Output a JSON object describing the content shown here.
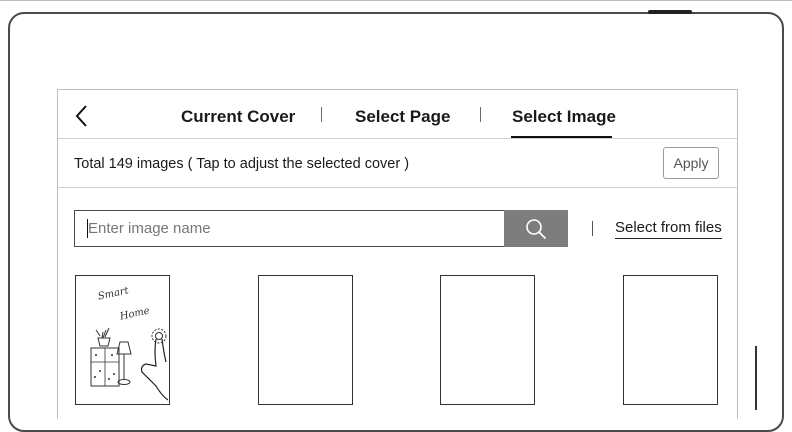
{
  "header": {
    "tabs": [
      {
        "label": "Current Cover",
        "selected": false
      },
      {
        "label": "Select Page",
        "selected": false
      },
      {
        "label": "Select Image",
        "selected": true
      }
    ]
  },
  "summary": {
    "total_text": "Total 149 images ( Tap to adjust the selected cover )",
    "apply_label": "Apply"
  },
  "search": {
    "placeholder": "Enter image name",
    "value": "",
    "icon": "search-icon"
  },
  "files": {
    "label": "Select from files"
  },
  "images": [
    {
      "name": "smart-home",
      "caption": "Smart Home"
    },
    {
      "name": "blank"
    },
    {
      "name": "blank"
    },
    {
      "name": "blank"
    }
  ],
  "colors": {
    "accent": "#111111",
    "search_button": "#7d7d7d",
    "border": "#bfbfbf"
  }
}
